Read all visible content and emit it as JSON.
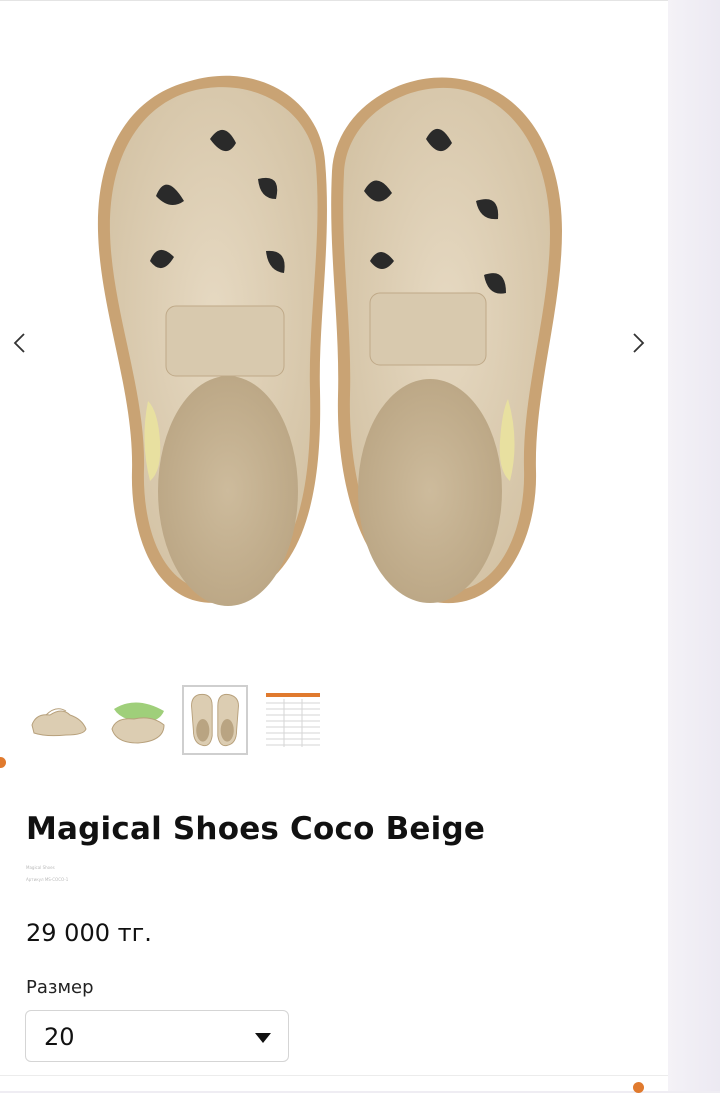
{
  "product": {
    "title": "Magical Shoes Coco Beige",
    "brand_small": "Magical Shoes",
    "sku_small": "Артикул MS-COCO-1",
    "price": "29 000 тг."
  },
  "gallery": {
    "main_image": "coco-beige-top-view",
    "thumbnails": [
      {
        "name": "shoes-side-view"
      },
      {
        "name": "shoes-sole-view"
      },
      {
        "name": "shoes-top-view",
        "active": true
      },
      {
        "name": "size-chart"
      }
    ],
    "prev_icon": "chevron-left-icon",
    "next_icon": "chevron-right-icon"
  },
  "size": {
    "label": "Размер",
    "selected": "20",
    "caret_icon": "caret-down-icon"
  },
  "colors": {
    "accent": "#e07a2e",
    "leather": "#dccdb2",
    "sole": "#c9a374"
  }
}
